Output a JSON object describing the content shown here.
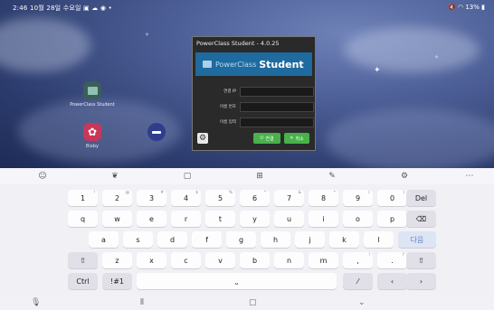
{
  "status_bar": {
    "time_date": "2:46  10월 28일 수요일",
    "right": "13%"
  },
  "home_apps": [
    {
      "label": "PowerClass Student"
    },
    {
      "label": "Bixby"
    },
    {
      "label": ""
    }
  ],
  "dialog": {
    "title": "PowerClass Student - 4.0.25",
    "banner_brand": "PowerClass",
    "banner_product": "Student",
    "fields": [
      {
        "label": "연결 IP",
        "value": ""
      },
      {
        "label": "이름 번호",
        "value": ""
      },
      {
        "label": "이름 입력",
        "value": ""
      }
    ],
    "connect_label": "연결",
    "cancel_label": "취소"
  },
  "toolbar": {
    "icons": [
      "emoji-icon",
      "sticker-icon",
      "clipboard-icon",
      "one-handed-icon",
      "handwriting-icon",
      "settings-icon",
      "more-icon"
    ]
  },
  "keyboard": {
    "row1": [
      {
        "k": "1",
        "h": "!"
      },
      {
        "k": "2",
        "h": "@"
      },
      {
        "k": "3",
        "h": "#"
      },
      {
        "k": "4",
        "h": "$"
      },
      {
        "k": "5",
        "h": "%"
      },
      {
        "k": "6",
        "h": "^"
      },
      {
        "k": "7",
        "h": "&"
      },
      {
        "k": "8",
        "h": "*"
      },
      {
        "k": "9",
        "h": "("
      },
      {
        "k": "0",
        "h": ")"
      }
    ],
    "del": "Del",
    "row2": [
      "q",
      "w",
      "e",
      "r",
      "t",
      "y",
      "u",
      "i",
      "o",
      "p"
    ],
    "row3": [
      "a",
      "s",
      "d",
      "f",
      "g",
      "h",
      "j",
      "k",
      "l"
    ],
    "enter": "다음",
    "row4": [
      "z",
      "x",
      "c",
      "v",
      "b",
      "n",
      "m"
    ],
    "row4_punct": [
      {
        "k": ",",
        "h": "!"
      },
      {
        "k": ".",
        "h": "?"
      }
    ],
    "ctrl": "Ctrl",
    "sym": "!#1",
    "lang": "⁄"
  }
}
